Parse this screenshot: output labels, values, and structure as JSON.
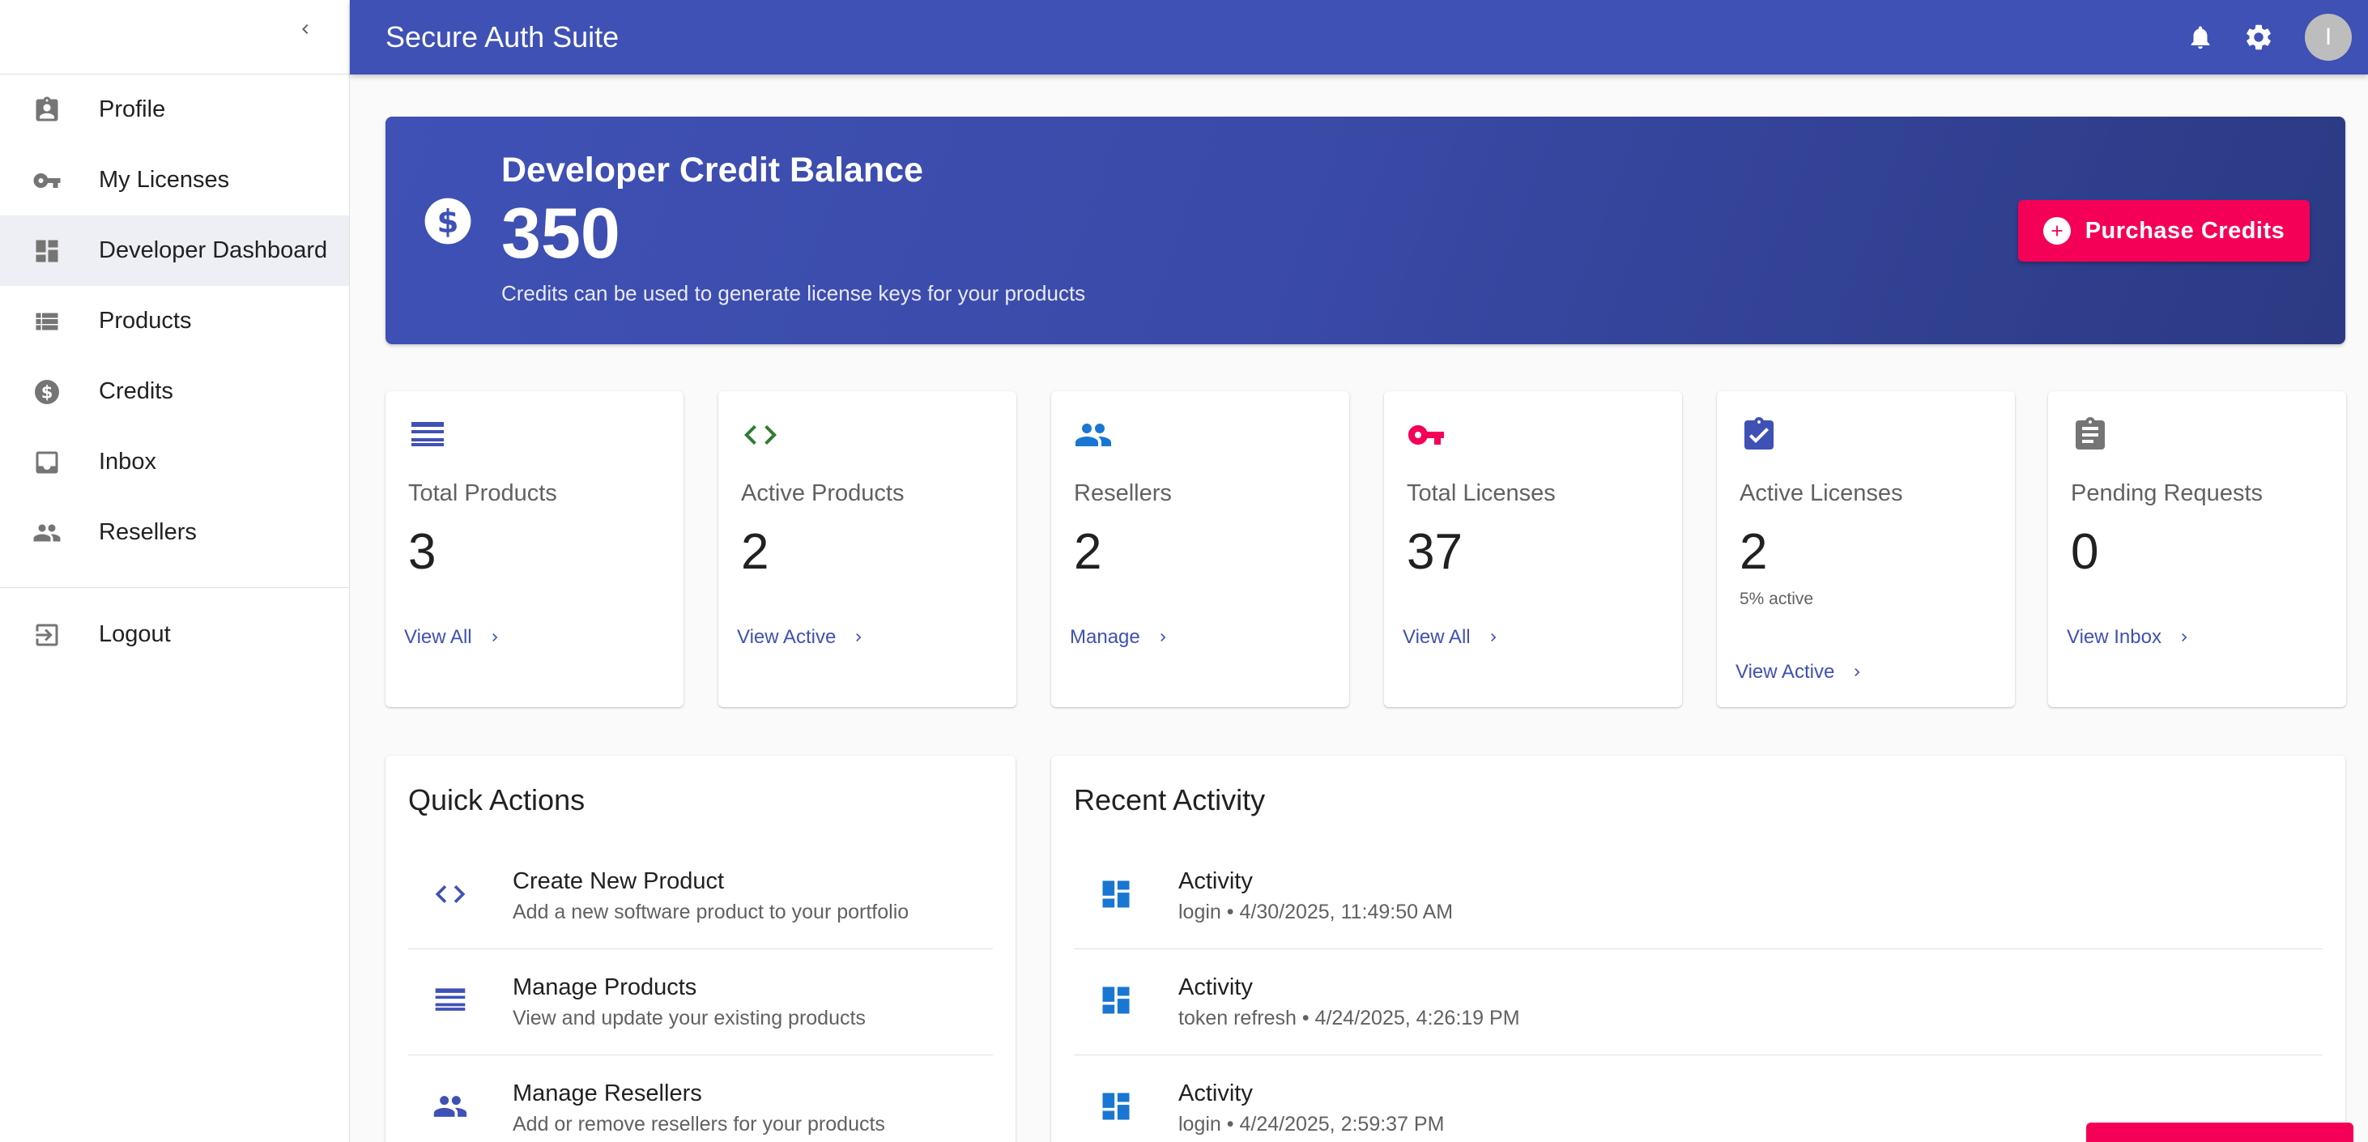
{
  "app": {
    "title": "Secure Auth Suite",
    "avatar_initial": "I"
  },
  "sidebar": {
    "items": [
      {
        "label": "Profile",
        "icon": "badge-icon"
      },
      {
        "label": "My Licenses",
        "icon": "key-icon"
      },
      {
        "label": "Developer Dashboard",
        "icon": "dashboard-icon",
        "active": true
      },
      {
        "label": "Products",
        "icon": "list-icon"
      },
      {
        "label": "Credits",
        "icon": "dollar-icon"
      },
      {
        "label": "Inbox",
        "icon": "inbox-icon"
      },
      {
        "label": "Resellers",
        "icon": "people-icon"
      }
    ],
    "logout_label": "Logout"
  },
  "banner": {
    "title": "Developer Credit Balance",
    "value": "350",
    "subtitle": "Credits can be used to generate license keys for your products",
    "button_label": "Purchase Credits"
  },
  "stats": [
    {
      "label": "Total Products",
      "value": "3",
      "link": "View All",
      "icon": "list-icon",
      "icon_color": "#3f51b5"
    },
    {
      "label": "Active Products",
      "value": "2",
      "link": "View Active",
      "icon": "code-icon",
      "icon_color": "#2e7d32"
    },
    {
      "label": "Resellers",
      "value": "2",
      "link": "Manage",
      "icon": "people-icon",
      "icon_color": "#1976d2"
    },
    {
      "label": "Total Licenses",
      "value": "37",
      "link": "View All",
      "icon": "key-icon",
      "icon_color": "#f50057"
    },
    {
      "label": "Active Licenses",
      "value": "2",
      "note": "5% active",
      "link": "View Active",
      "icon": "check-box-icon",
      "icon_color": "#3f51b5"
    },
    {
      "label": "Pending Requests",
      "value": "0",
      "link": "View Inbox",
      "icon": "clipboard-icon",
      "icon_color": "#757575"
    }
  ],
  "quick_actions": {
    "title": "Quick Actions",
    "items": [
      {
        "primary": "Create New Product",
        "secondary": "Add a new software product to your portfolio",
        "icon": "code-icon"
      },
      {
        "primary": "Manage Products",
        "secondary": "View and update your existing products",
        "icon": "list-icon"
      },
      {
        "primary": "Manage Resellers",
        "secondary": "Add or remove resellers for your products",
        "icon": "people-icon"
      }
    ]
  },
  "recent_activity": {
    "title": "Recent Activity",
    "items": [
      {
        "primary": "Activity",
        "secondary": "login • 4/30/2025, 11:49:50 AM"
      },
      {
        "primary": "Activity",
        "secondary": "token refresh • 4/24/2025, 4:26:19 PM"
      },
      {
        "primary": "Activity",
        "secondary": "login • 4/24/2025, 2:59:37 PM"
      }
    ]
  },
  "colors": {
    "primary": "#3f51b5",
    "accent": "#f50057"
  }
}
